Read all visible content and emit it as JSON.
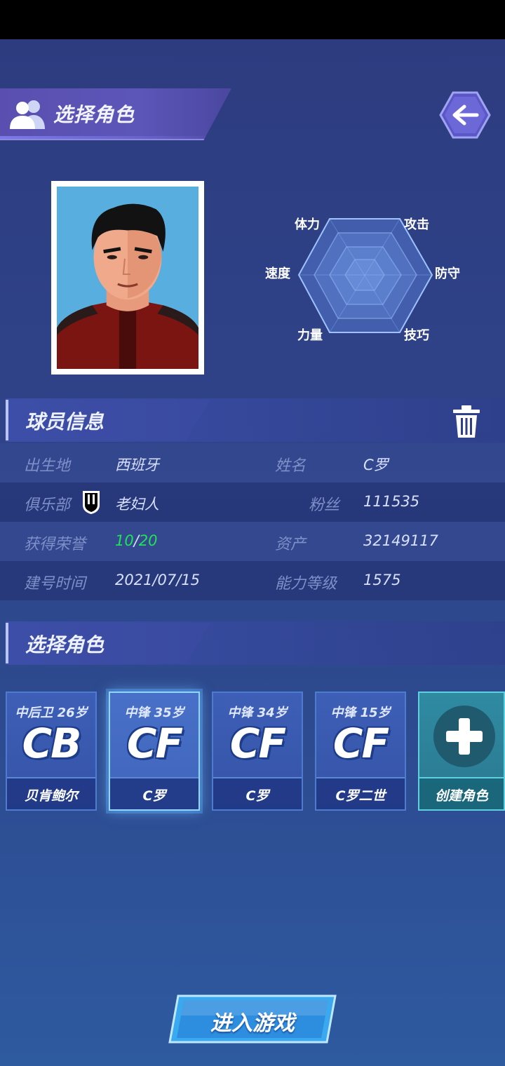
{
  "header": {
    "title": "选择角色"
  },
  "radar": {
    "labels": [
      "体力",
      "攻击",
      "防守",
      "技巧",
      "力量",
      "速度"
    ]
  },
  "player_info": {
    "section_title": "球员信息",
    "rows": [
      {
        "label_left": "出生地",
        "value_left": "西班牙",
        "label_right": "姓名",
        "value_right": "C罗"
      },
      {
        "label_left": "俱乐部",
        "value_left": "老妇人",
        "label_right": "粉丝",
        "value_right": "111535"
      },
      {
        "label_left": "获得荣誉",
        "value_left_a": "10",
        "value_left_sep": "/",
        "value_left_b": "20",
        "label_right": "资产",
        "value_right": "32149117"
      },
      {
        "label_left": "建号时间",
        "value_left": "2021/07/15",
        "label_right": "能力等级",
        "value_right": "1575"
      }
    ]
  },
  "character_select": {
    "section_title": "选择角色",
    "cards": [
      {
        "top": "中后卫 26岁",
        "pos": "CB",
        "name": "贝肯鲍尔",
        "selected": false
      },
      {
        "top": "中锋 35岁",
        "pos": "CF",
        "name": "C罗",
        "selected": true
      },
      {
        "top": "中锋 34岁",
        "pos": "CF",
        "name": "C罗",
        "selected": false
      },
      {
        "top": "中锋 15岁",
        "pos": "CF",
        "name": "C罗二世",
        "selected": false
      }
    ],
    "create_label": "创建角色"
  },
  "enter_button": {
    "label": "进入游戏"
  },
  "colors": {
    "honor_green": "#23e05a",
    "label_blue": "#7f8fc8"
  }
}
